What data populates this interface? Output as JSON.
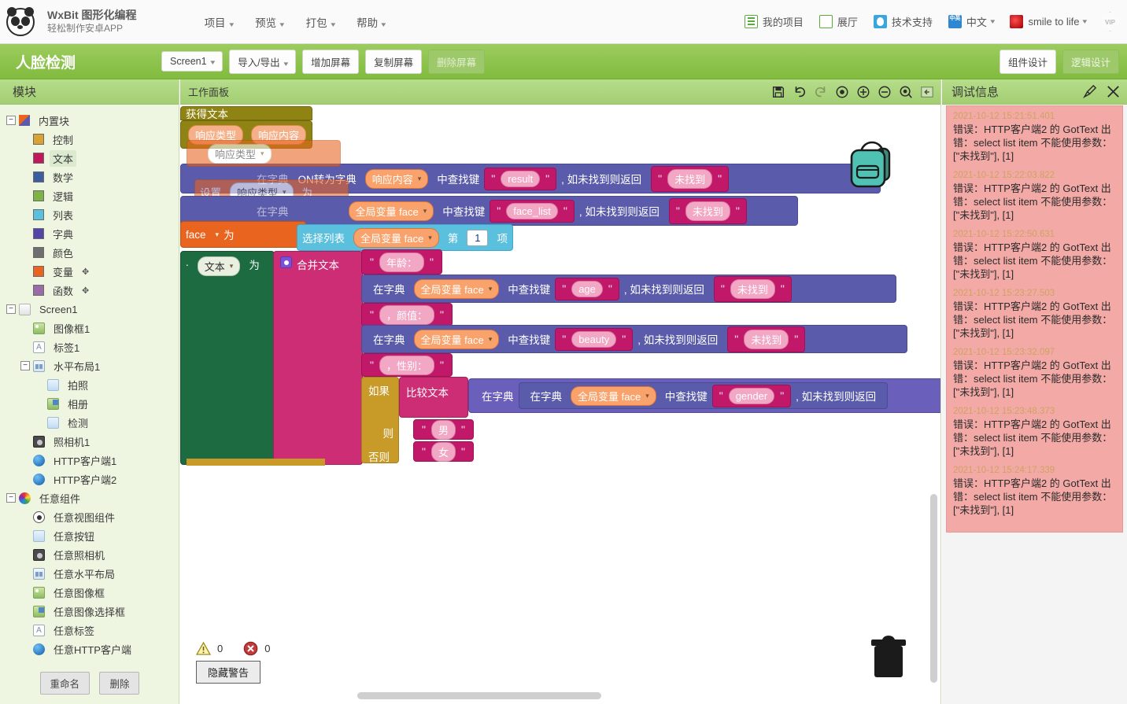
{
  "topbar": {
    "brand_title": "WxBit 图形化编程",
    "brand_sub": "轻松制作安卓APP",
    "menu": [
      {
        "label": "项目",
        "icon": "chevron-down-icon"
      },
      {
        "label": "预览",
        "icon": "chevron-down-icon"
      },
      {
        "label": "打包",
        "icon": "chevron-down-icon"
      },
      {
        "label": "帮助",
        "icon": "chevron-down-icon"
      }
    ],
    "right": [
      {
        "label": "我的项目",
        "icon": "list-icon"
      },
      {
        "label": "展厅",
        "icon": "grid-icon"
      },
      {
        "label": "技术支持",
        "icon": "qq-support-icon"
      },
      {
        "label": "中文",
        "icon": "language-icon",
        "icon_text": "中英"
      },
      {
        "label": "smile to life",
        "icon": "user-avatar-icon"
      }
    ],
    "vip_badge": "VIP"
  },
  "projectbar": {
    "title": "人脸检测",
    "screen_select": "Screen1",
    "import_export": "导入/导出",
    "add_screen": "增加屏幕",
    "copy_screen": "复制屏幕",
    "delete_screen": "删除屏幕",
    "designer_tab": "组件设计",
    "blocks_tab": "逻辑设计",
    "accent_color": "#8bc34a"
  },
  "sidebar": {
    "header": "模块",
    "tree": [
      {
        "label": "内置块",
        "depth": 0,
        "toggle": "−",
        "icon": "blocks-icon"
      },
      {
        "label": "控制",
        "depth": 1,
        "swatch": "#d9a233"
      },
      {
        "label": "文本",
        "depth": 1,
        "swatch": "#c2185b",
        "selected": true
      },
      {
        "label": "数学",
        "depth": 1,
        "swatch": "#3b5f9e"
      },
      {
        "label": "逻辑",
        "depth": 1,
        "swatch": "#7cb342"
      },
      {
        "label": "列表",
        "depth": 1,
        "swatch": "#5bc0de"
      },
      {
        "label": "字典",
        "depth": 1,
        "swatch": "#5145a8"
      },
      {
        "label": "颜色",
        "depth": 1,
        "swatch": "#6e6e6e"
      },
      {
        "label": "变量",
        "depth": 1,
        "swatch": "#e8641f",
        "gear": true
      },
      {
        "label": "函数",
        "depth": 1,
        "swatch": "#9b6aa8",
        "gear": true
      },
      {
        "label": "Screen1",
        "depth": 0,
        "toggle": "−",
        "icon": "screen-icon"
      },
      {
        "label": "图像框1",
        "depth": 1,
        "icon": "image-icon"
      },
      {
        "label": "标签1",
        "depth": 1,
        "icon": "label-icon"
      },
      {
        "label": "水平布局1",
        "depth": 1,
        "toggle": "−",
        "icon": "horizontal-layout-icon"
      },
      {
        "label": "拍照",
        "depth": 2,
        "icon": "button-icon"
      },
      {
        "label": "相册",
        "depth": 2,
        "icon": "image-picker-icon"
      },
      {
        "label": "检测",
        "depth": 2,
        "icon": "button-icon"
      },
      {
        "label": "照相机1",
        "depth": 1,
        "icon": "camera-icon"
      },
      {
        "label": "HTTP客户端1",
        "depth": 1,
        "icon": "web-icon"
      },
      {
        "label": "HTTP客户端2",
        "depth": 1,
        "icon": "web-icon"
      },
      {
        "label": "任意组件",
        "depth": 0,
        "toggle": "−",
        "icon": "any-component-icon"
      },
      {
        "label": "任意视图组件",
        "depth": 1,
        "icon": "any-view-icon"
      },
      {
        "label": "任意按钮",
        "depth": 1,
        "icon": "button-icon"
      },
      {
        "label": "任意照相机",
        "depth": 1,
        "icon": "camera-icon"
      },
      {
        "label": "任意水平布局",
        "depth": 1,
        "icon": "horizontal-layout-icon"
      },
      {
        "label": "任意图像框",
        "depth": 1,
        "icon": "image-icon"
      },
      {
        "label": "任意图像选择框",
        "depth": 1,
        "icon": "image-picker-icon"
      },
      {
        "label": "任意标签",
        "depth": 1,
        "icon": "label-icon"
      },
      {
        "label": "任意HTTP客户端",
        "depth": 1,
        "icon": "web-icon"
      }
    ],
    "rename_button": "重命名",
    "delete_button": "删除"
  },
  "workspace": {
    "header": "工作面板",
    "tools": [
      {
        "name": "save-icon"
      },
      {
        "name": "undo-icon"
      },
      {
        "name": "redo-icon"
      },
      {
        "name": "center-icon"
      },
      {
        "name": "zoom-in-icon"
      },
      {
        "name": "zoom-out-icon"
      },
      {
        "name": "screenshot-icon"
      },
      {
        "name": "collapse-panel-icon"
      }
    ],
    "warning_count": "0",
    "error_count": "0",
    "hide_warnings": "隐藏警告",
    "blocks": {
      "get_text": "获得文本",
      "response_type": "响应类型",
      "response_content": "响应内容",
      "set": "设置",
      "as": "为",
      "in_dict": "在字典",
      "json_to_dict": "ON转为字典",
      "find_key": "中查找键",
      "if_not_found": ", 如未找到则返回",
      "not_found": "未找到",
      "global_face": "全局变量 face",
      "key_result": "result",
      "key_face_list": "face_list",
      "key_age": "age",
      "key_beauty": "beauty",
      "key_gender": "gender",
      "select_list": "选择列表",
      "item_nth": "第",
      "item_index": "1",
      "item_suffix": "项",
      "text_field": "文本",
      "join_text": "合并文本",
      "str_age": "年龄：",
      "str_beauty": "，颜值：",
      "str_gender": "，性别：",
      "if_label": "如果",
      "compare_text": "比较文本",
      "then_label": "则",
      "else_label": "否则",
      "male": "男",
      "female": "女",
      "face_cut": "face"
    }
  },
  "debug": {
    "header": "调试信息",
    "clear_icon": "broom-icon",
    "close_icon": "close-icon",
    "entries": [
      {
        "time": "2021-10-12 15:21:51.401",
        "text": "错误：HTTP客户端2 的 GotText 出错：select list item 不能使用参数：[\"未找到\"], [1]"
      },
      {
        "time": "2021-10-12 15:22:03.822",
        "text": "错误：HTTP客户端2 的 GotText 出错：select list item 不能使用参数：[\"未找到\"], [1]"
      },
      {
        "time": "2021-10-12 15:22:50.631",
        "text": "错误：HTTP客户端2 的 GotText 出错：select list item 不能使用参数：[\"未找到\"], [1]"
      },
      {
        "time": "2021-10-12 15:23:27.503",
        "text": "错误：HTTP客户端2 的 GotText 出错：select list item 不能使用参数：[\"未找到\"], [1]"
      },
      {
        "time": "2021-10-12 15:23:32.097",
        "text": "错误：HTTP客户端2 的 GotText 出错：select list item 不能使用参数：[\"未找到\"], [1]"
      },
      {
        "time": "2021-10-12 15:23:48.373",
        "text": "错误：HTTP客户端2 的 GotText 出错：select list item 不能使用参数：[\"未找到\"], [1]"
      },
      {
        "time": "2021-10-12 15:24:17.339",
        "text": "错误：HTTP客户端2 的 GotText 出错：select list item 不能使用参数：[\"未找到\"], [1]"
      }
    ]
  }
}
